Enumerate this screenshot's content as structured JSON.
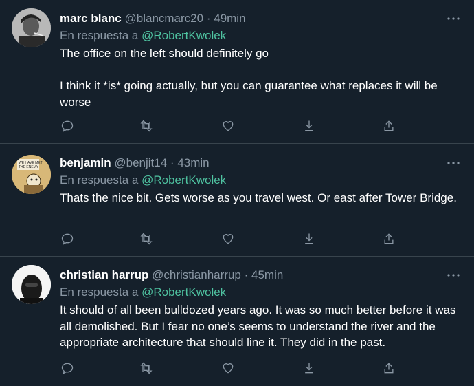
{
  "tweets": [
    {
      "name": "marc blanc",
      "handle": "@blancmarc20",
      "time": "49min",
      "reply_prefix": "En respuesta a",
      "reply_to": "@RobertKwolek",
      "text": "The office on the left should definitely go\n\nI think it *is* going actually, but you can guarantee what replaces it will be worse"
    },
    {
      "name": "benjamin",
      "handle": "@benjit14",
      "time": "43min",
      "reply_prefix": "En respuesta a",
      "reply_to": "@RobertKwolek",
      "text": "Thats the nice bit. Gets worse as you travel west. Or east after Tower Bridge."
    },
    {
      "name": "christian harrup",
      "handle": "@christianharrup",
      "time": "45min",
      "reply_prefix": "En respuesta a",
      "reply_to": "@RobertKwolek",
      "text": "It should of all been bulldozed years ago. It was so much better before it was all demolished. But I fear no one’s seems to understand the river and the appropriate architecture that should line it. They did in the past."
    }
  ],
  "separator": "·",
  "icons": [
    "more-icon",
    "reply-icon",
    "retweet-icon",
    "like-icon",
    "download-icon",
    "share-icon"
  ],
  "colors": {
    "background": "#15202b",
    "mention": "#4fc3a1",
    "muted": "#8b98a5",
    "border": "#38444d"
  }
}
